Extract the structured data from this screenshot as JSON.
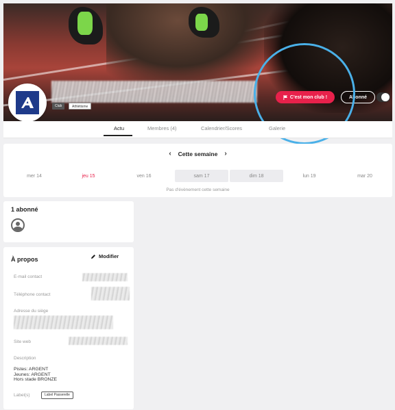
{
  "club": {
    "tags": [
      "Club",
      "Athlétisme"
    ],
    "primary_action": "C'est mon club !",
    "secondary_action": "Abonné"
  },
  "tabs": [
    {
      "label": "Actu",
      "active": true
    },
    {
      "label": "Membres (4)",
      "active": false
    },
    {
      "label": "Calendrier/Scores",
      "active": false
    },
    {
      "label": "Galerie",
      "active": false
    }
  ],
  "calendar": {
    "week_label": "Cette semaine",
    "days": [
      {
        "label": "mer 14",
        "state": "normal"
      },
      {
        "label": "jeu 15",
        "state": "today"
      },
      {
        "label": "ven 16",
        "state": "normal"
      },
      {
        "label": "sam 17",
        "state": "weekend"
      },
      {
        "label": "dim 18",
        "state": "weekend"
      },
      {
        "label": "lun 19",
        "state": "normal"
      },
      {
        "label": "mar 20",
        "state": "normal"
      }
    ],
    "empty_message": "Pas d'évènement cette semaine"
  },
  "subscribers": {
    "title": "1 abonné"
  },
  "about": {
    "title": "À propos",
    "edit_label": "Modifier",
    "email_label": "E-mail contact",
    "phone_label": "Téléphone contact",
    "address_label": "Adresse du siège",
    "website_label": "Site web",
    "description_label": "Description",
    "description_text": "Pistes: ARGENT\nJeunes: ARGENT\nHors stade BRONZE",
    "labels_label": "Label(s)",
    "labels": [
      "Label Passerelle"
    ]
  },
  "colors": {
    "accent_red": "#e8214b",
    "highlight_ring": "#4ab0e8",
    "logo_blue": "#1e3a8a"
  },
  "icons": {
    "flag": "flag-icon",
    "chevron_left": "chevron-left-icon",
    "chevron_right": "chevron-right-icon",
    "pencil": "pencil-icon",
    "user": "user-icon"
  }
}
